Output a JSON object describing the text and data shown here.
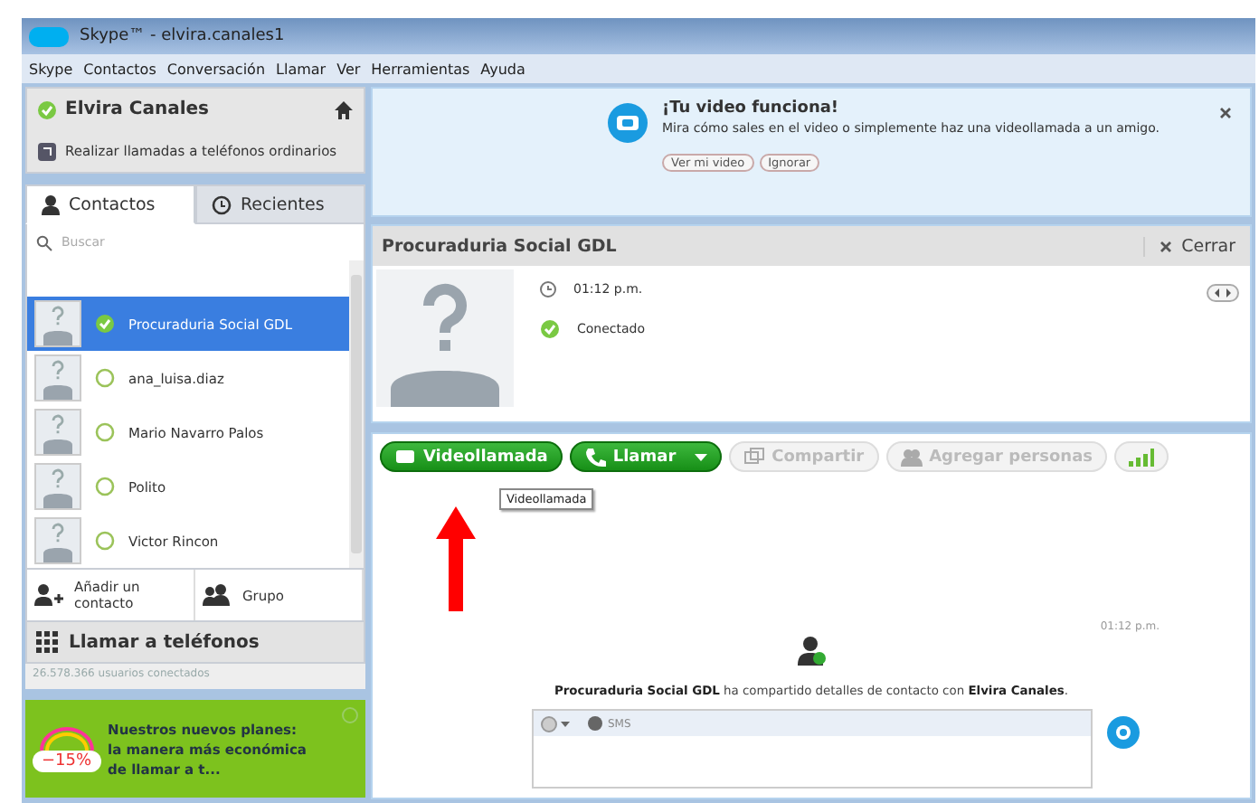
{
  "window": {
    "title": "Skype™ - elvira.canales1"
  },
  "menu": [
    "Skype",
    "Contactos",
    "Conversación",
    "Llamar",
    "Ver",
    "Herramientas",
    "Ayuda"
  ],
  "profile": {
    "name": "Elvira Canales",
    "call_phones_link": "Realizar llamadas a teléfonos ordinarios"
  },
  "tabs": [
    {
      "label": "Contactos",
      "selected": true
    },
    {
      "label": "Recientes",
      "selected": false
    }
  ],
  "search": {
    "placeholder": "Buscar"
  },
  "contacts": [
    {
      "name": "Procuraduria Social GDL",
      "selected": true
    },
    {
      "name": "ana_luisa.diaz",
      "selected": false
    },
    {
      "name": "Mario Navarro Palos",
      "selected": false
    },
    {
      "name": "Polito",
      "selected": false
    },
    {
      "name": "Victor Rincon",
      "selected": false
    }
  ],
  "contact_actions": [
    "Añadir un contacto",
    "Grupo"
  ],
  "call_phones": "Llamar a teléfonos",
  "online_count": "26.578.366 usuarios conectados",
  "promo": {
    "badge": "−15%",
    "text": "Nuestros nuevos planes: la manera más económica de llamar a t..."
  },
  "notification": {
    "title": "¡Tu video funciona!",
    "text": "Mira cómo sales en el video o simplemente haz una videollamada a un amigo.",
    "buttons": [
      "Ver mi video",
      "Ignorar"
    ]
  },
  "conversation": {
    "name": "Procuraduria Social GDL",
    "close": "Cerrar",
    "time": "01:12 p.m.",
    "status": "Conectado"
  },
  "toolbar": [
    {
      "label": "Videollamada",
      "kind": "video"
    },
    {
      "label": "Llamar",
      "kind": "call"
    },
    {
      "label": "Compartir",
      "kind": "share"
    },
    {
      "label": "Agregar personas",
      "kind": "add"
    },
    {
      "kind": "signal"
    }
  ],
  "tooltip": "Videollamada",
  "message": {
    "time": "01:12 p.m.",
    "text": "**Procuraduria Social GDL** ha compartido detalles de contacto con **Elvira Canales**."
  },
  "compose": {
    "mode": "SMS"
  }
}
